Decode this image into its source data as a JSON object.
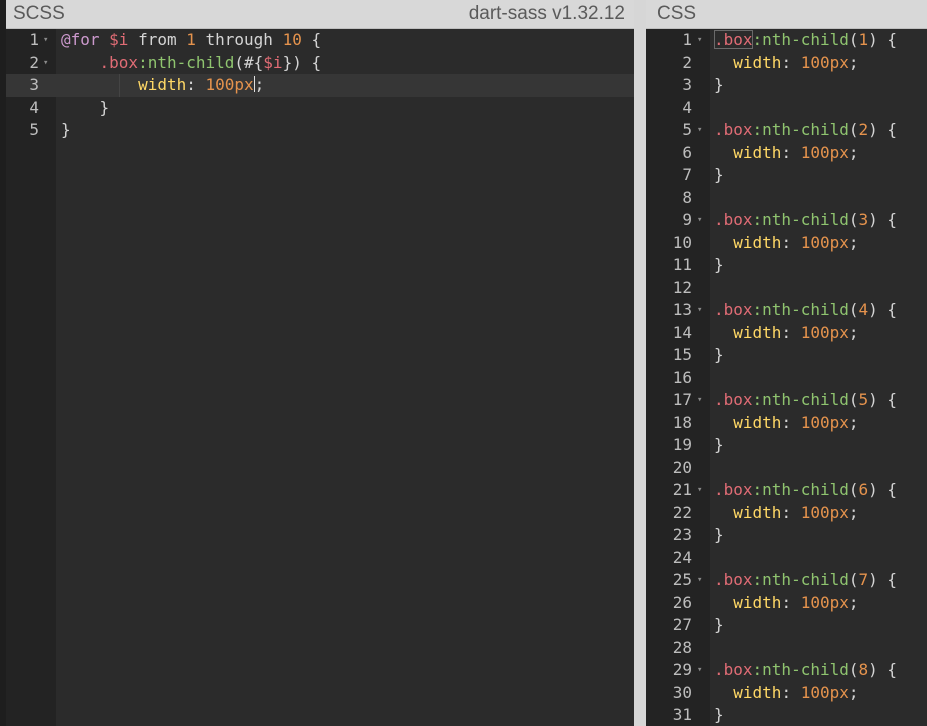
{
  "scss_panel": {
    "title": "SCSS",
    "compiler": "dart-sass v1.32.12",
    "active_line": 3,
    "lines": [
      {
        "n": "1",
        "fold": true,
        "indent": 0,
        "tokens": [
          {
            "t": "@for",
            "c": "keyword"
          },
          {
            "t": " ",
            "c": "plain"
          },
          {
            "t": "$i",
            "c": "variable"
          },
          {
            "t": " from ",
            "c": "plain"
          },
          {
            "t": "1",
            "c": "number"
          },
          {
            "t": " through ",
            "c": "plain"
          },
          {
            "t": "10",
            "c": "number"
          },
          {
            "t": " {",
            "c": "plain"
          }
        ]
      },
      {
        "n": "2",
        "fold": true,
        "indent": 1,
        "tokens": [
          {
            "t": ".box",
            "c": "selector"
          },
          {
            "t": ":nth-child",
            "c": "pseudo"
          },
          {
            "t": "(",
            "c": "paren"
          },
          {
            "t": "#{",
            "c": "interp"
          },
          {
            "t": "$i",
            "c": "variable"
          },
          {
            "t": "}",
            "c": "interp"
          },
          {
            "t": ")",
            "c": "paren"
          },
          {
            "t": " {",
            "c": "plain"
          }
        ]
      },
      {
        "n": "3",
        "fold": false,
        "indent": 2,
        "cursor_after": 3,
        "tokens": [
          {
            "t": "width",
            "c": "property"
          },
          {
            "t": ": ",
            "c": "punct"
          },
          {
            "t": "100",
            "c": "number"
          },
          {
            "t": "px",
            "c": "unit"
          },
          {
            "t": ";",
            "c": "punct"
          }
        ]
      },
      {
        "n": "4",
        "fold": false,
        "indent": 1,
        "tokens": [
          {
            "t": "}",
            "c": "plain"
          }
        ]
      },
      {
        "n": "5",
        "fold": false,
        "indent": 0,
        "tokens": [
          {
            "t": "}",
            "c": "plain"
          }
        ]
      }
    ]
  },
  "css_panel": {
    "title": "CSS",
    "lines": [
      {
        "n": "1",
        "fold": true,
        "kind": "open",
        "idx": "1"
      },
      {
        "n": "2",
        "fold": false,
        "kind": "prop"
      },
      {
        "n": "3",
        "fold": false,
        "kind": "close"
      },
      {
        "n": "4",
        "fold": false,
        "kind": "blank"
      },
      {
        "n": "5",
        "fold": true,
        "kind": "open",
        "idx": "2"
      },
      {
        "n": "6",
        "fold": false,
        "kind": "prop"
      },
      {
        "n": "7",
        "fold": false,
        "kind": "close"
      },
      {
        "n": "8",
        "fold": false,
        "kind": "blank"
      },
      {
        "n": "9",
        "fold": true,
        "kind": "open",
        "idx": "3"
      },
      {
        "n": "10",
        "fold": false,
        "kind": "prop"
      },
      {
        "n": "11",
        "fold": false,
        "kind": "close"
      },
      {
        "n": "12",
        "fold": false,
        "kind": "blank"
      },
      {
        "n": "13",
        "fold": true,
        "kind": "open",
        "idx": "4"
      },
      {
        "n": "14",
        "fold": false,
        "kind": "prop"
      },
      {
        "n": "15",
        "fold": false,
        "kind": "close"
      },
      {
        "n": "16",
        "fold": false,
        "kind": "blank"
      },
      {
        "n": "17",
        "fold": true,
        "kind": "open",
        "idx": "5"
      },
      {
        "n": "18",
        "fold": false,
        "kind": "prop"
      },
      {
        "n": "19",
        "fold": false,
        "kind": "close"
      },
      {
        "n": "20",
        "fold": false,
        "kind": "blank"
      },
      {
        "n": "21",
        "fold": true,
        "kind": "open",
        "idx": "6"
      },
      {
        "n": "22",
        "fold": false,
        "kind": "prop"
      },
      {
        "n": "23",
        "fold": false,
        "kind": "close"
      },
      {
        "n": "24",
        "fold": false,
        "kind": "blank"
      },
      {
        "n": "25",
        "fold": true,
        "kind": "open",
        "idx": "7"
      },
      {
        "n": "26",
        "fold": false,
        "kind": "prop"
      },
      {
        "n": "27",
        "fold": false,
        "kind": "close"
      },
      {
        "n": "28",
        "fold": false,
        "kind": "blank"
      },
      {
        "n": "29",
        "fold": true,
        "kind": "open",
        "idx": "8"
      },
      {
        "n": "30",
        "fold": false,
        "kind": "prop"
      },
      {
        "n": "31",
        "fold": false,
        "kind": "close"
      }
    ],
    "selector_class": ".box",
    "selector_pseudo": ":nth-child",
    "property": "width",
    "property_value": "100",
    "property_unit": "px"
  },
  "fold_glyph": "▾",
  "colors": {
    "keyword": "#cc99cd",
    "variable": "#e06c75",
    "number": "#e5934d",
    "pseudo": "#8fc46f",
    "property": "#ffd866"
  }
}
